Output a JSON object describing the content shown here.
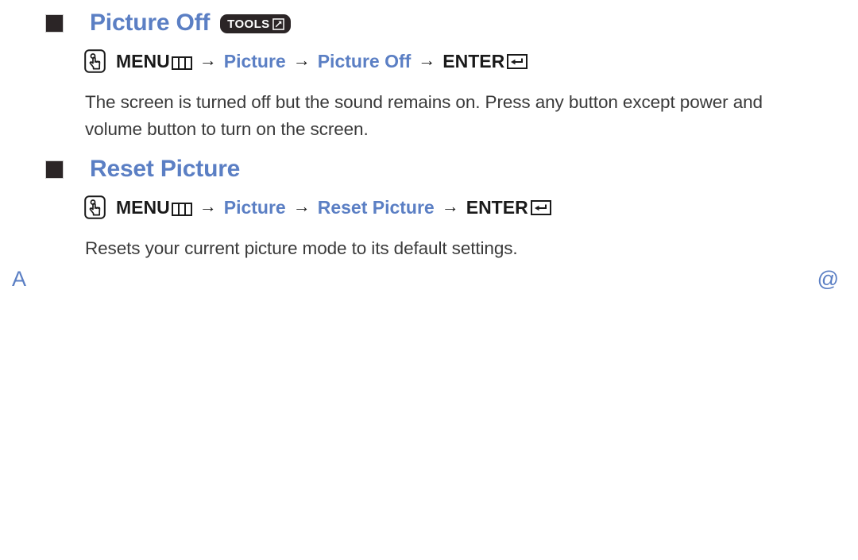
{
  "accent_color": "#5b7fc4",
  "body_text_color": "#3a3a3a",
  "bullet_color": "#2b2526",
  "badge_color": "#2b2526",
  "sections": [
    {
      "title": "Picture Off",
      "badge": {
        "label": "TOOLS",
        "icon": "tools-arrow-icon"
      },
      "path": {
        "lead_icon": "remote-button-press-icon",
        "items": [
          {
            "text": "MENU",
            "style": "dark",
            "icon": "menu-grid-icon"
          },
          {
            "text": "Picture",
            "style": "accent",
            "icon": ""
          },
          {
            "text": "Picture Off",
            "style": "accent",
            "icon": ""
          },
          {
            "text": "ENTER",
            "style": "dark",
            "icon": "enter-return-icon"
          }
        ],
        "separator": "→"
      },
      "description": "The screen is turned off but the sound remains on. Press any button except power and volume button to turn on the screen."
    },
    {
      "title": "Reset Picture",
      "badge": null,
      "path": {
        "lead_icon": "remote-button-press-icon",
        "items": [
          {
            "text": "MENU",
            "style": "dark",
            "icon": "menu-grid-icon"
          },
          {
            "text": "Picture",
            "style": "accent",
            "icon": ""
          },
          {
            "text": "Reset Picture",
            "style": "accent",
            "icon": ""
          },
          {
            "text": "ENTER",
            "style": "dark",
            "icon": "enter-return-icon"
          }
        ],
        "separator": "→"
      },
      "description": "Resets your current picture mode to its default settings."
    }
  ],
  "footer": {
    "left_marker": "A",
    "right_marker": "@"
  }
}
